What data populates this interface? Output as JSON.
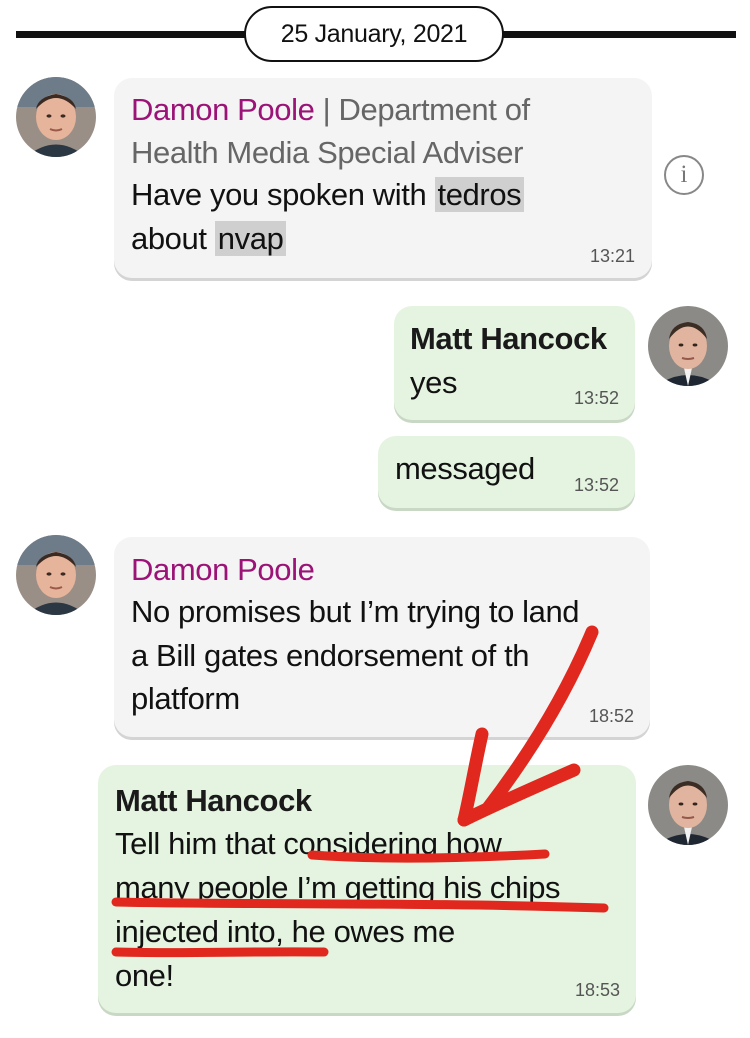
{
  "date_divider": "25 January, 2021",
  "messages": [
    {
      "sender": "Damon Poole",
      "role": "| Department of Health Media Special Adviser",
      "role_lines": [
        "| Department of",
        "Health Media Special Adviser"
      ],
      "lines": [
        "Have you spoken with ",
        "tedros",
        "about ",
        "nvap"
      ],
      "highlighted_words": [
        "tedros",
        "nvap"
      ],
      "time": "13:21",
      "direction": "incoming"
    },
    {
      "sender": "Matt Hancock",
      "lines": [
        "yes"
      ],
      "time": "13:52",
      "direction": "outgoing"
    },
    {
      "sender": "",
      "lines": [
        "messaged"
      ],
      "time": "13:52",
      "direction": "outgoing"
    },
    {
      "sender": "Damon Poole",
      "lines": [
        "No promises but I’m trying to land",
        "a Bill gates endorsement of th",
        "platform"
      ],
      "time": "18:52",
      "direction": "incoming"
    },
    {
      "sender": "Matt Hancock",
      "lines": [
        "Tell him that considering how",
        "many people I’m getting his chips",
        "injected into, he owes me",
        "one!"
      ],
      "time": "18:53",
      "direction": "outgoing"
    }
  ],
  "icons": {
    "info": "i"
  },
  "colors": {
    "incoming_bubble": "#f4f4f4",
    "outgoing_bubble": "#e5f4e1",
    "damon_name": "#9b1376",
    "annotation_red": "#e0281e",
    "highlight": "#cfcfcf"
  }
}
